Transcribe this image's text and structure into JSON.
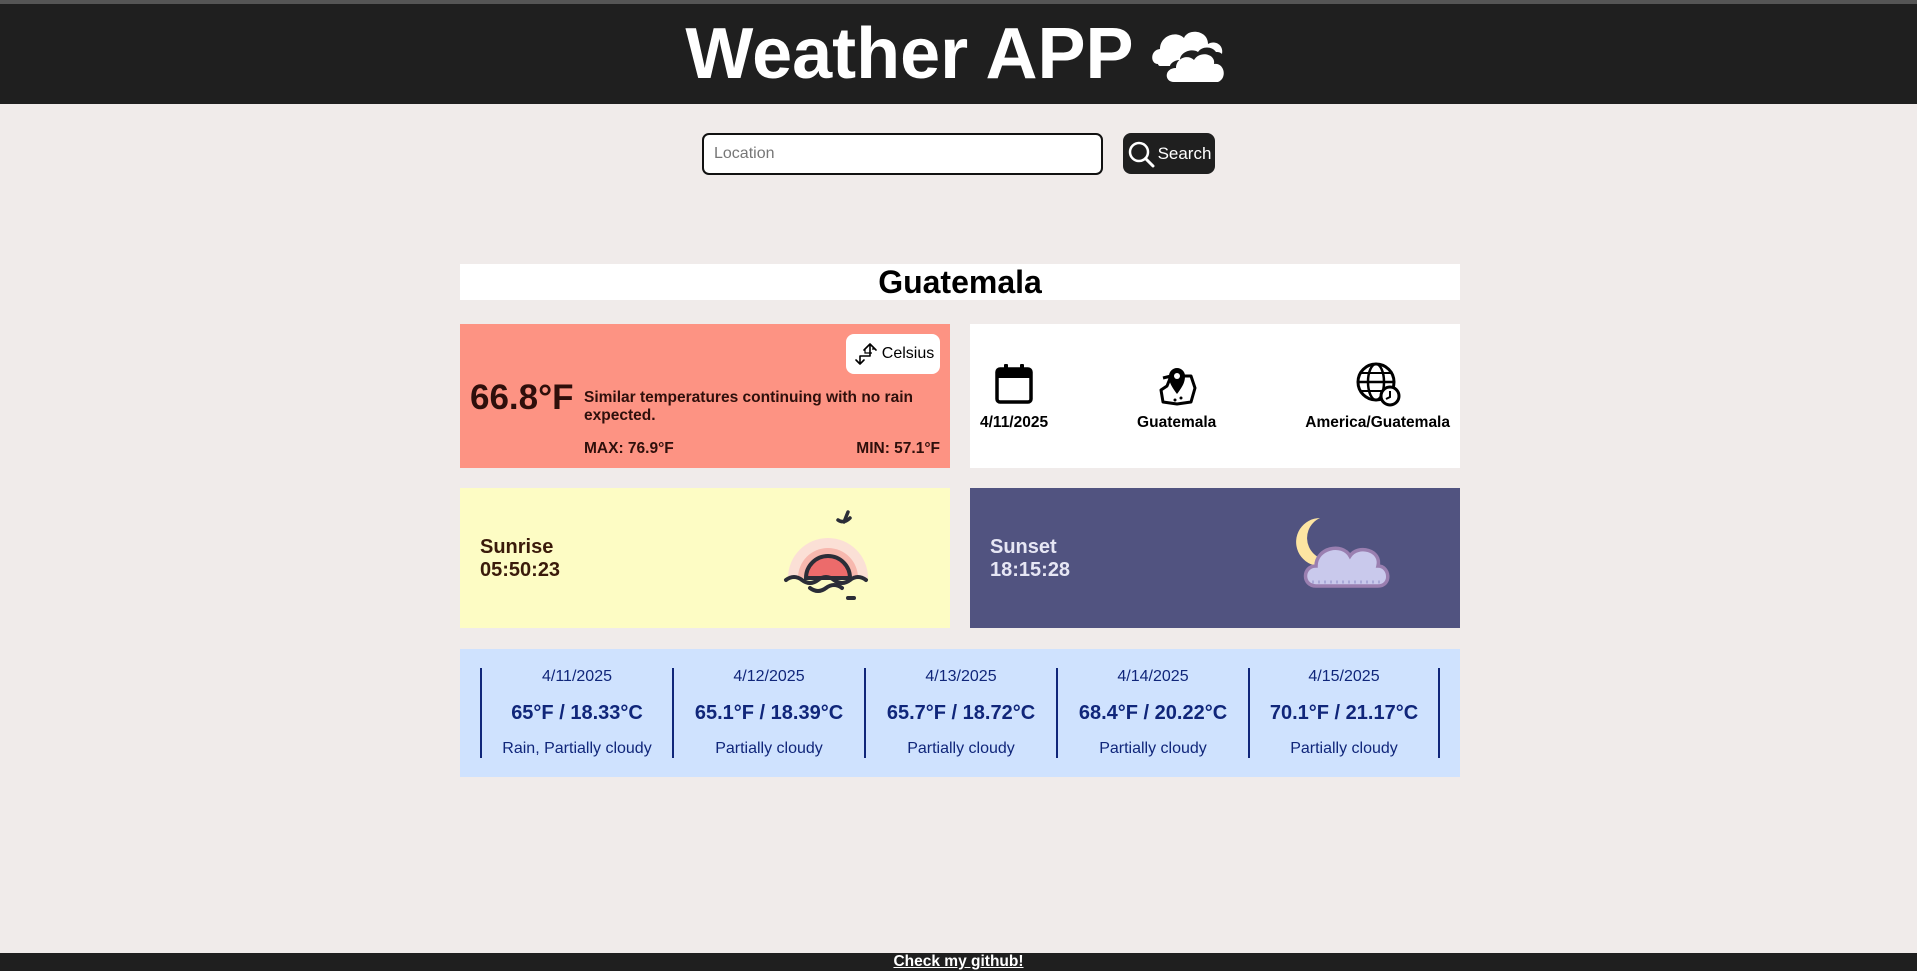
{
  "header": {
    "title": "Weather APP"
  },
  "search": {
    "placeholder": "Location",
    "value": "",
    "button_label": "Search"
  },
  "location": {
    "name": "Guatemala"
  },
  "current": {
    "temperature": "66.8°F",
    "description": "Similar temperatures continuing with no rain expected.",
    "max": "MAX: 76.9°F",
    "min": "MIN: 57.1°F",
    "unit_toggle_label": "Celsius"
  },
  "info": {
    "date": "4/11/2025",
    "place": "Guatemala",
    "timezone": "America/Guatemala"
  },
  "sunrise": {
    "label": "Sunrise",
    "time": "05:50:23"
  },
  "sunset": {
    "label": "Sunset",
    "time": "18:15:28"
  },
  "forecast": [
    {
      "date": "4/11/2025",
      "temp": "65°F / 18.33°C",
      "conditions": "Rain, Partially cloudy"
    },
    {
      "date": "4/12/2025",
      "temp": "65.1°F / 18.39°C",
      "conditions": "Partially cloudy"
    },
    {
      "date": "4/13/2025",
      "temp": "65.7°F / 18.72°C",
      "conditions": "Partially cloudy"
    },
    {
      "date": "4/14/2025",
      "temp": "68.4°F / 20.22°C",
      "conditions": "Partially cloudy"
    },
    {
      "date": "4/15/2025",
      "temp": "70.1°F / 21.17°C",
      "conditions": "Partially cloudy"
    }
  ],
  "footer": {
    "link_text": "Check my github!"
  },
  "colors": {
    "header_bg": "#1f1f1f",
    "page_bg": "#f0ebea",
    "temp_card": "#fd9383",
    "sunrise_card": "#fdfcc4",
    "sunset_card": "#515380",
    "forecast_bg": "#cfe2fe",
    "forecast_text": "#10267a"
  }
}
